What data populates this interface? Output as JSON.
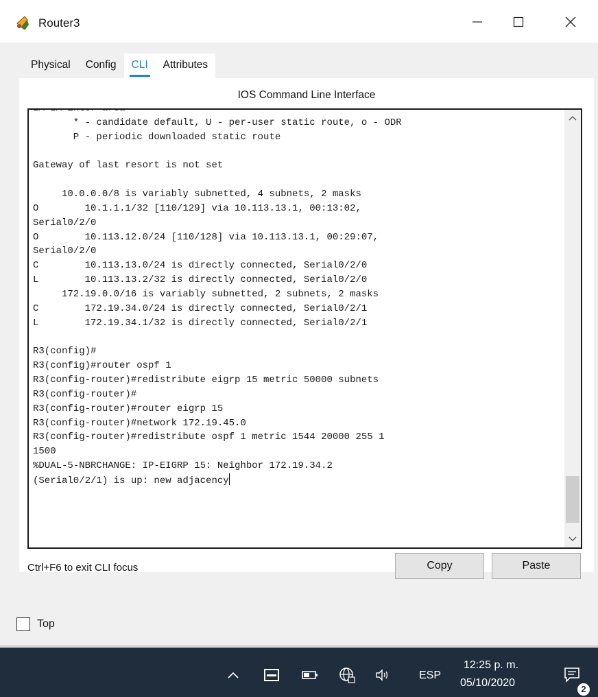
{
  "window": {
    "title": "Router3",
    "icons": {
      "app": "router-icon",
      "minimize": "minimize-icon",
      "maximize": "maximize-icon",
      "close": "close-icon"
    }
  },
  "tabs": [
    {
      "label": "Physical",
      "active": false
    },
    {
      "label": "Config",
      "active": false
    },
    {
      "label": "CLI",
      "active": true
    },
    {
      "label": "Attributes",
      "active": false
    }
  ],
  "panel": {
    "title": "IOS Command Line Interface",
    "terminal_lines": [
      "IA-IA inter area",
      "       * - candidate default, U - per-user static route, o - ODR",
      "       P - periodic downloaded static route",
      "",
      "Gateway of last resort is not set",
      "",
      "     10.0.0.0/8 is variably subnetted, 4 subnets, 2 masks",
      "O        10.1.1.1/32 [110/129] via 10.113.13.1, 00:13:02,",
      "Serial0/2/0",
      "O        10.113.12.0/24 [110/128] via 10.113.13.1, 00:29:07,",
      "Serial0/2/0",
      "C        10.113.13.0/24 is directly connected, Serial0/2/0",
      "L        10.113.13.2/32 is directly connected, Serial0/2/0",
      "     172.19.0.0/16 is variably subnetted, 2 subnets, 2 masks",
      "C        172.19.34.0/24 is directly connected, Serial0/2/1",
      "L        172.19.34.1/32 is directly connected, Serial0/2/1",
      "",
      "R3(config)#",
      "R3(config)#router ospf 1",
      "R3(config-router)#redistribute eigrp 15 metric 50000 subnets",
      "R3(config-router)#",
      "R3(config-router)#router eigrp 15",
      "R3(config-router)#network 172.19.45.0",
      "R3(config-router)#redistribute ospf 1 metric 1544 20000 255 1",
      "1500",
      "%DUAL-5-NBRCHANGE: IP-EIGRP 15: Neighbor 172.19.34.2",
      "(Serial0/2/1) is up: new adjacency"
    ],
    "hint": "Ctrl+F6 to exit CLI focus",
    "copy_label": "Copy",
    "paste_label": "Paste"
  },
  "top_checkbox": {
    "label": "Top",
    "checked": false
  },
  "taskbar": {
    "language": "ESP",
    "time": "12:25 p. m.",
    "date": "05/10/2020",
    "notification_count": "2",
    "icons": [
      "chevron-up-icon",
      "keyboard-icon",
      "battery-icon",
      "network-globe-icon",
      "volume-icon",
      "notification-icon"
    ]
  },
  "colors": {
    "accent": "#1a86d0",
    "taskbar": "#1f2d3d",
    "window_bg": "#f0f0f0"
  }
}
